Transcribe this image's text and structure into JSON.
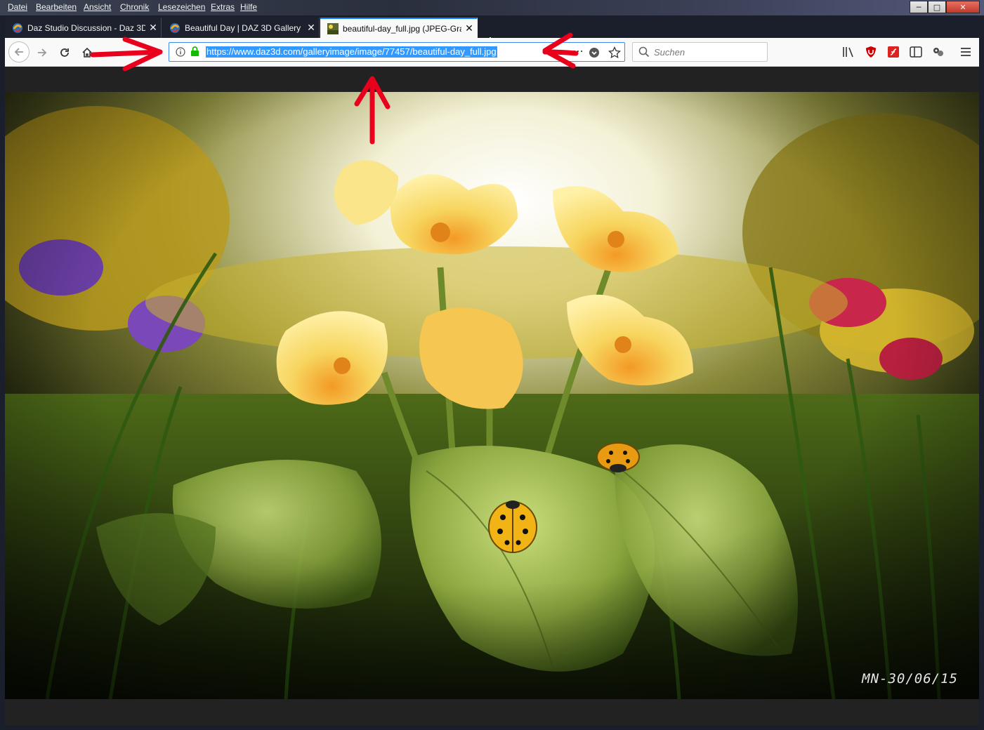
{
  "menubar": {
    "items": [
      "Datei",
      "Bearbeiten",
      "Ansicht",
      "Chronik",
      "Lesezeichen",
      "Extras",
      "Hilfe"
    ]
  },
  "tabs": [
    {
      "title": "Daz Studio Discussion - Daz 3D",
      "active": false,
      "icon": "daz-favicon-icon"
    },
    {
      "title": "Beautiful Day | DAZ 3D Gallery",
      "active": false,
      "icon": "daz-favicon-icon"
    },
    {
      "title": "beautiful-day_full.jpg (JPEG-Grafik",
      "active": true,
      "icon": "image-thumbnail-icon"
    }
  ],
  "navbar": {
    "url": "https://www.daz3d.com/galleryimage/image/77457/beautiful-day_full.jpg",
    "search_placeholder": "Suchen"
  },
  "image": {
    "watermark": "MN-30/06/15"
  },
  "colors": {
    "accent": "#0a84ff",
    "selection": "#3399ff",
    "annotation_red": "#e8001c"
  }
}
